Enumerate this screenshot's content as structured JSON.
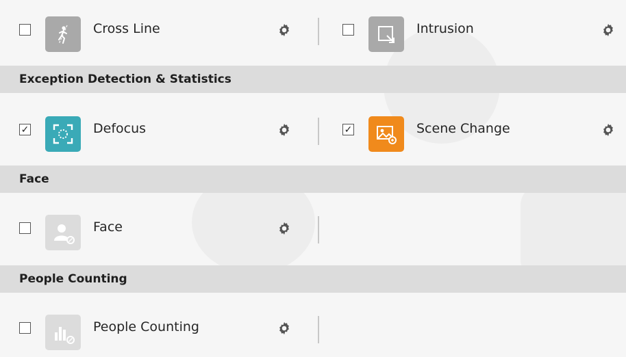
{
  "row1": {
    "left": {
      "label": "Cross Line",
      "checked": false,
      "icon": "cross-line-icon"
    },
    "right": {
      "label": "Intrusion",
      "checked": false,
      "icon": "intrusion-icon"
    }
  },
  "section_exception": {
    "title": "Exception Detection & Statistics"
  },
  "row2": {
    "left": {
      "label": "Defocus",
      "checked": true,
      "check_glyph": "✓",
      "icon": "defocus-icon"
    },
    "right": {
      "label": "Scene Change",
      "checked": true,
      "check_glyph": "✓",
      "icon": "scene-change-icon"
    }
  },
  "section_face": {
    "title": "Face"
  },
  "row3": {
    "left": {
      "label": "Face",
      "checked": false,
      "icon": "face-icon"
    }
  },
  "section_people": {
    "title": "People Counting"
  },
  "row4": {
    "left": {
      "label": "People Counting",
      "checked": false,
      "icon": "people-counting-icon"
    }
  },
  "colors": {
    "section_bg": "#dcdcdc",
    "defocus_icon_bg": "#3aaab7",
    "scene_change_icon_bg": "#f08a1c",
    "disabled_icon_bg": "#a9a9a9"
  }
}
